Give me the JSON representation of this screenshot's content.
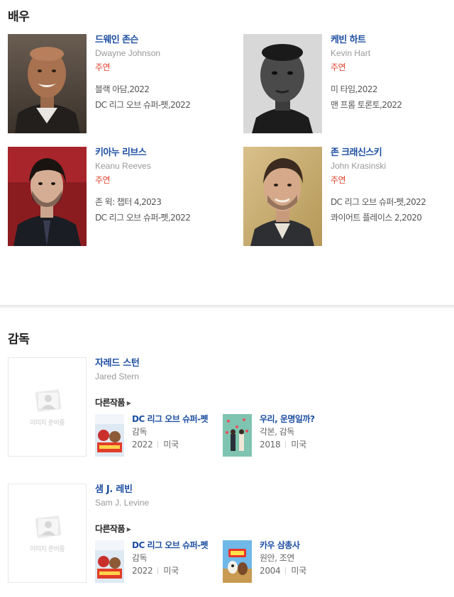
{
  "sections": {
    "actors_title": "배우",
    "directors_title": "감독"
  },
  "actors": [
    {
      "name": "드웨인 존슨",
      "english_name": "Dwayne Johnson",
      "role": "주연",
      "works": [
        "블랙 아담,2022",
        "DC 리그 오브 슈퍼-펫,2022"
      ]
    },
    {
      "name": "케빈 하트",
      "english_name": "Kevin Hart",
      "role": "주연",
      "works": [
        "미 타임,2022",
        "맨 프롬 토론토,2022"
      ]
    },
    {
      "name": "키아누 리브스",
      "english_name": "Keanu Reeves",
      "role": "주연",
      "works": [
        "존 윅: 챕터 4,2023",
        "DC 리그 오브 슈퍼-펫,2022"
      ]
    },
    {
      "name": "존 크래신스키",
      "english_name": "John Krasinski",
      "role": "주연",
      "works": [
        "DC 리그 오브 슈퍼-펫,2022",
        "콰이어트 플레이스 2,2020"
      ]
    }
  ],
  "directors": [
    {
      "name": "자레드 스턴",
      "english_name": "Jared Stern",
      "placeholder_text": "이미지 준비중",
      "other_works_label": "다른작품",
      "works": [
        {
          "title": "DC 리그 오브 슈퍼-펫",
          "role": "감독",
          "year": "2022",
          "country": "미국"
        },
        {
          "title": "우리, 운명일까?",
          "role": "각본, 감독",
          "year": "2018",
          "country": "미국"
        }
      ]
    },
    {
      "name": "샘 J. 레빈",
      "english_name": "Sam J. Levine",
      "placeholder_text": "이미지 준비중",
      "other_works_label": "다른작품",
      "works": [
        {
          "title": "DC 리그 오브 슈퍼-펫",
          "role": "감독",
          "year": "2022",
          "country": "미국"
        },
        {
          "title": "카우 삼총사",
          "role": "원안, 조연",
          "year": "2004",
          "country": "미국"
        }
      ]
    }
  ],
  "colors": {
    "name_link": "#1d4fa1",
    "role_red": "#e4432d",
    "muted": "#999999"
  },
  "icons": {
    "placeholder": "person-placeholder-icon",
    "more_arrow": "chevron-right-icon"
  }
}
